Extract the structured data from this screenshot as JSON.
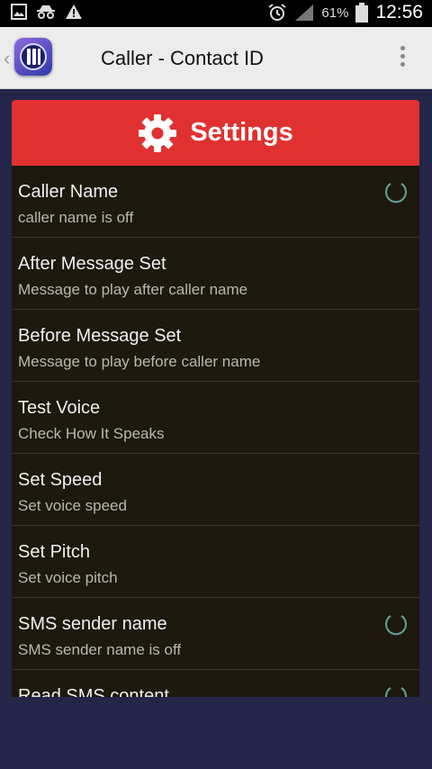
{
  "status_bar": {
    "battery": "61%",
    "time": "12:56"
  },
  "app_bar": {
    "title": "Caller - Contact ID"
  },
  "settings_header": {
    "title": "Settings"
  },
  "settings_items": [
    {
      "title": "Caller Name",
      "summary": "caller name is off",
      "has_toggle": true
    },
    {
      "title": "After Message Set",
      "summary": "Message to play after caller name",
      "has_toggle": false
    },
    {
      "title": "Before Message Set",
      "summary": "Message to play before caller name",
      "has_toggle": false
    },
    {
      "title": "Test Voice",
      "summary": "Check How It Speaks",
      "has_toggle": false
    },
    {
      "title": "Set Speed",
      "summary": "Set voice speed",
      "has_toggle": false
    },
    {
      "title": "Set Pitch",
      "summary": "Set voice pitch",
      "has_toggle": false
    },
    {
      "title": "SMS sender name",
      "summary": "SMS sender name is off",
      "has_toggle": true
    },
    {
      "title": "Read SMS content",
      "summary": "",
      "has_toggle": true
    }
  ],
  "colors": {
    "header_red": "#e03130",
    "panel_bg": "#1d190d",
    "page_bg": "#232648",
    "toggle": "#5fa5a0"
  }
}
